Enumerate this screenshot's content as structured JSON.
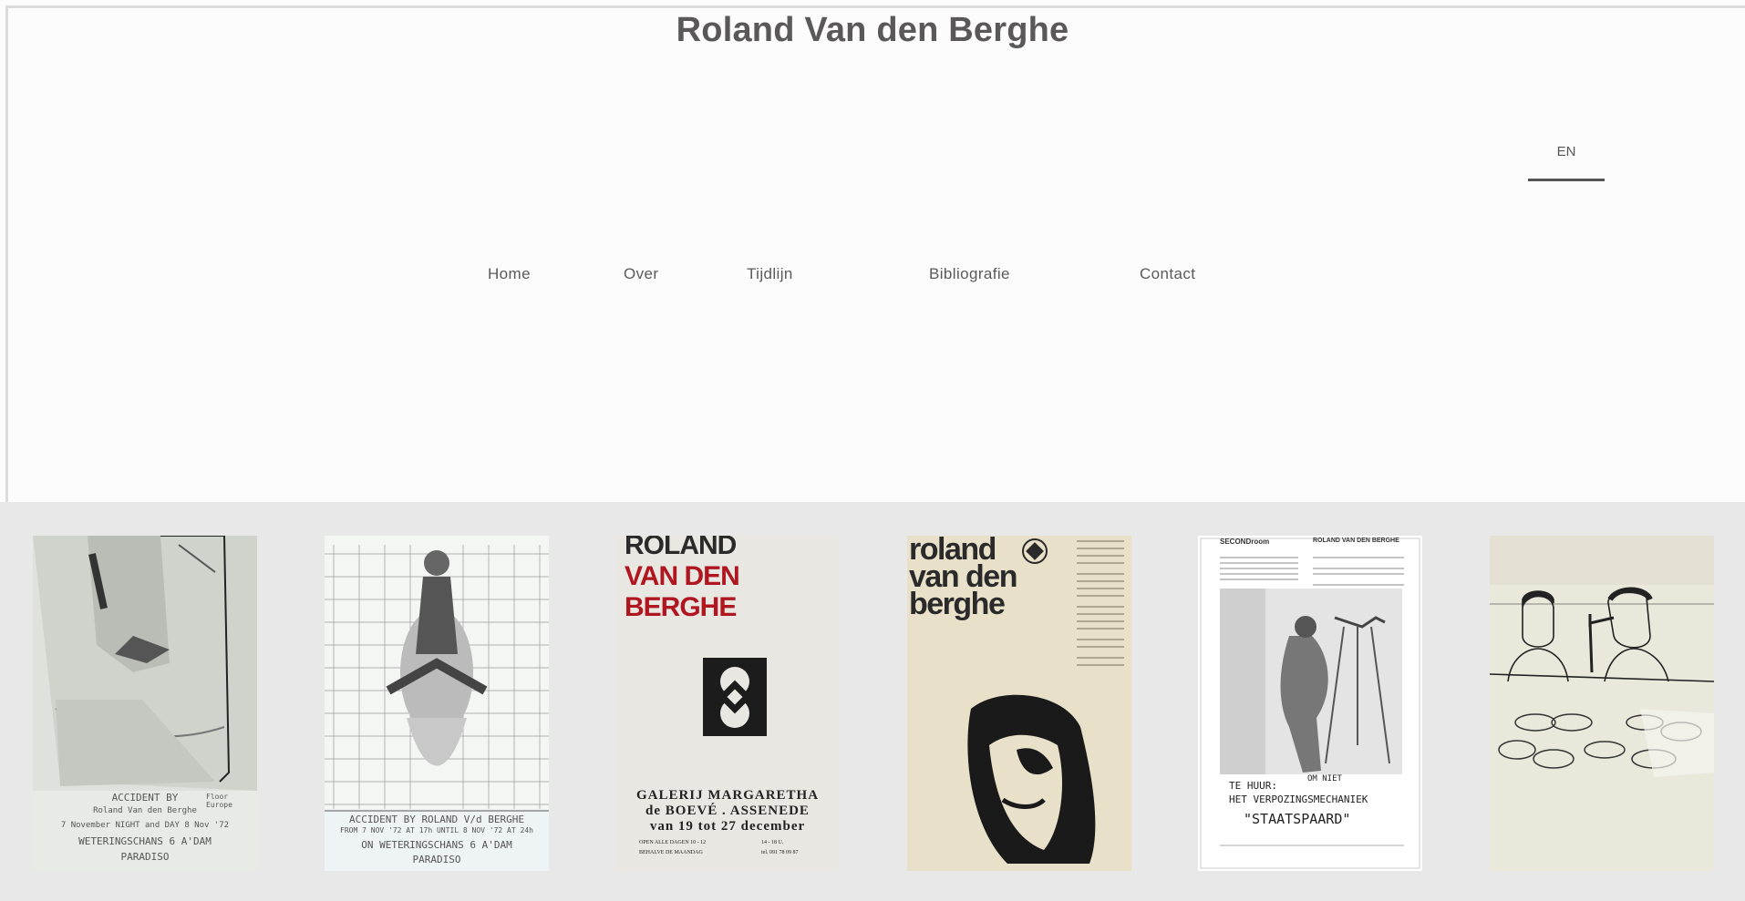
{
  "site": {
    "title": "Roland Van den Berghe"
  },
  "language": {
    "current": "EN"
  },
  "nav": {
    "items": [
      {
        "label": "Home"
      },
      {
        "label": "Over"
      },
      {
        "label": "Tijdlijn"
      },
      {
        "label": "Bibliografie"
      },
      {
        "label": "Contact"
      }
    ]
  },
  "colors": {
    "background": "#fcfcfc",
    "gallery_band": "#e8e8e8",
    "text": "#555555",
    "accent_red": "#b01620"
  },
  "gallery": {
    "posters": [
      {
        "lines": [
          "ACCIDENT BY",
          "Roland Van den Berghe",
          "7 November NIGHT and DAY 8 Nov '72",
          "WETERINGSCHANS 6 A'DAM",
          "PARADISO"
        ],
        "side_text": "Floor Europe"
      },
      {
        "lines": [
          "ACCIDENT BY ROLAND V/d BERGHE",
          "FROM 7 NOV '72 AT 17h UNTIL 8 NOV '72 AT 24h",
          "ON WETERINGSCHANS 6 A'DAM",
          "PARADISO"
        ]
      },
      {
        "headline": [
          "ROLAND",
          "VAN DEN BERGHE"
        ],
        "lines": [
          "GALERIJ MARGARETHA",
          "de BOEVÉ . ASSENEDE",
          "van 19 tot 27 december"
        ],
        "small_left": [
          "OPEN ALLE DAGEN 10 - 12",
          "BEHALVE DE MAANDAG"
        ],
        "small_right": [
          "14 - 18 U.",
          "tel. 091 78 09 87"
        ]
      },
      {
        "headline": [
          "roland",
          "van den",
          "berghe"
        ]
      },
      {
        "header_left": "SECONDroom",
        "header_right": "ROLAND VAN DEN BERGHE",
        "lines": [
          "TE HUUR:",
          "OM NIET",
          "HET VERPOZINGSMECHANIEK",
          "\"STAATSPAARD\""
        ]
      },
      {
        "lines": []
      }
    ]
  }
}
